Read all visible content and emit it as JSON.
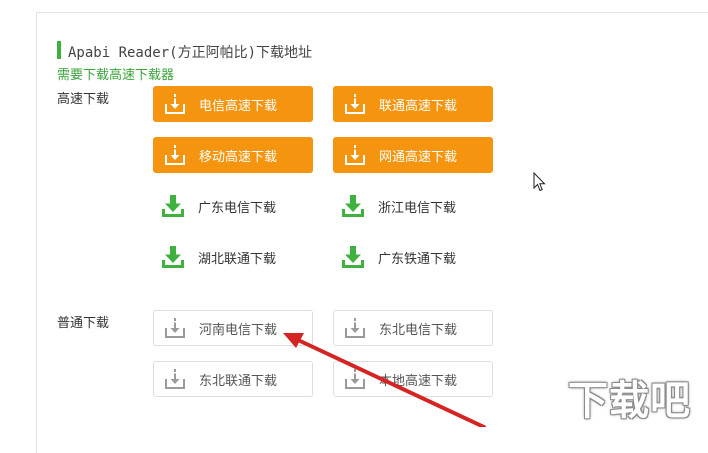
{
  "header": {
    "title": "Apabi Reader(方正阿帕比)下载地址",
    "subtitle": "需要下载高速下载器"
  },
  "sections": {
    "high_speed_label": "高速下载",
    "normal_label": "普通下载"
  },
  "high_speed": {
    "telecom": "电信高速下载",
    "unicom": "联通高速下载",
    "mobile": "移动高速下载",
    "netcom": "网通高速下载"
  },
  "mirrors": {
    "gd_telecom": "广东电信下载",
    "zj_telecom": "浙江电信下载",
    "hb_unicom": "湖北联通下载",
    "gd_railcom": "广东铁通下载"
  },
  "normal": {
    "hn_telecom": "河南电信下载",
    "ne_telecom": "东北电信下载",
    "ne_unicom": "东北联通下载",
    "local": "本地高速下载"
  },
  "watermark": {
    "text": "下载吧"
  },
  "colors": {
    "orange": "#f5940f",
    "green": "#3fb13f",
    "gray_icon": "#9a9a9a",
    "arrow": "#d42424"
  },
  "icons": {
    "download_box": "download-box-icon",
    "download_arrow": "download-arrow-icon"
  }
}
